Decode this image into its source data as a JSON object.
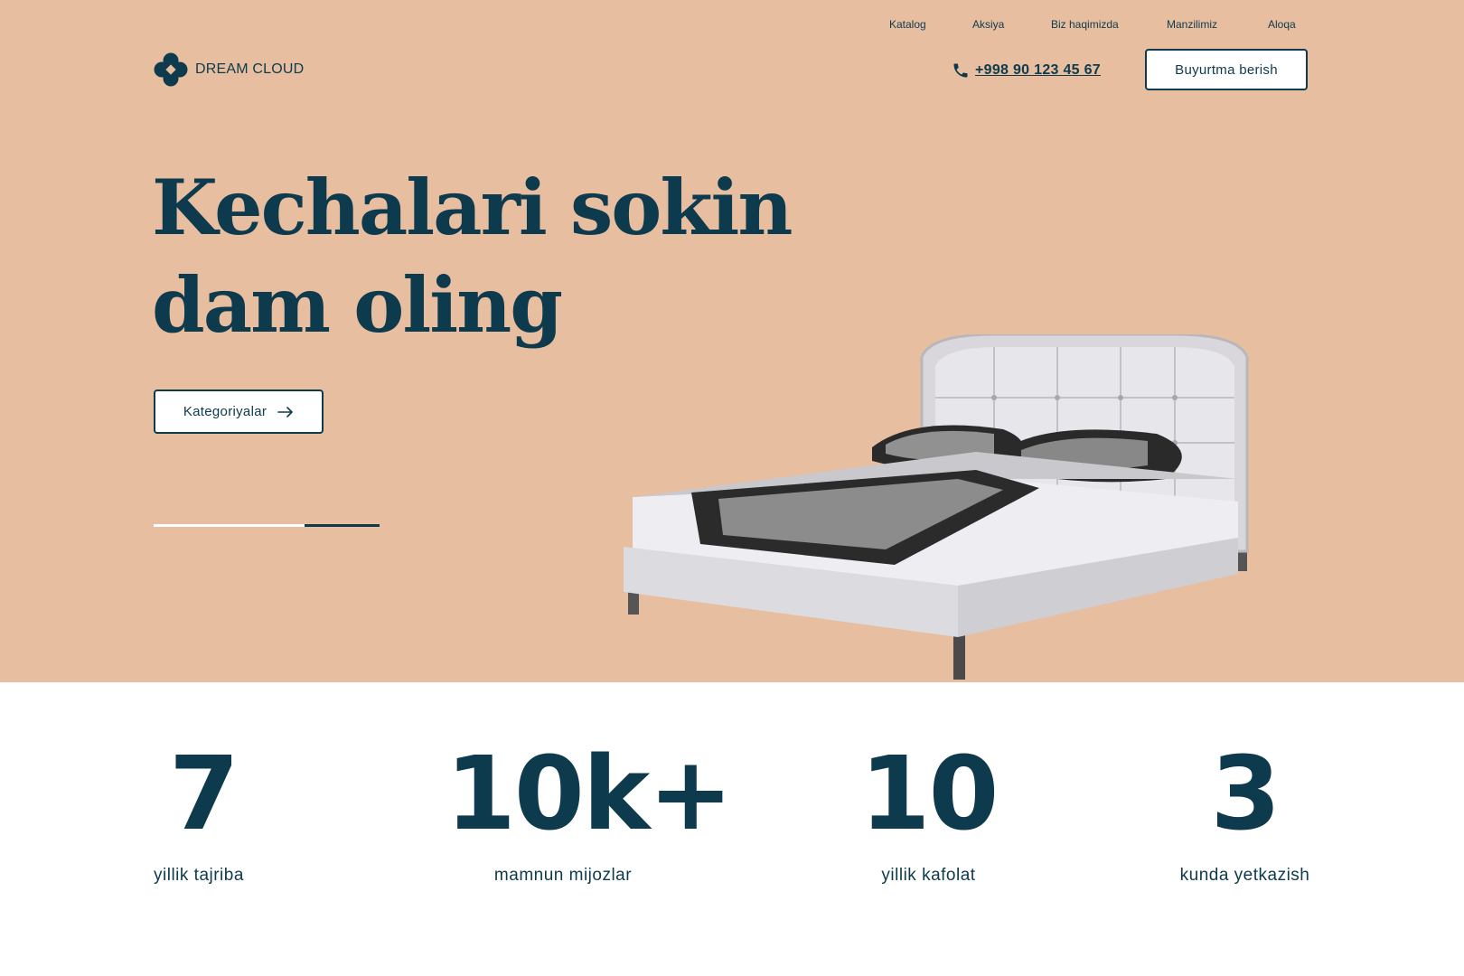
{
  "colors": {
    "hero_bg": "#e8bea0",
    "primary": "#0d3a4c",
    "surface": "#ffffff"
  },
  "nav": {
    "items": [
      "Katalog",
      "Aksiya",
      "Biz haqimizda",
      "Manzilimiz",
      "Aloqa"
    ]
  },
  "brand": {
    "name": "DREAM CLOUD",
    "logo_icon": "clover-logo-icon"
  },
  "contact": {
    "phone": "+998 90 123 45 67",
    "icon": "phone-icon"
  },
  "header": {
    "order_label": "Buyurtma berish"
  },
  "hero": {
    "headline_line1": "Kechalari sokin",
    "headline_line2": "dam oling",
    "cta_label": "Kategoriyalar",
    "cta_icon": "arrow-right-icon",
    "slider": {
      "total_slides": 3,
      "active_slide": 3
    },
    "image": "bed-icon"
  },
  "stats": [
    {
      "value": "7",
      "label": "yillik tajriba"
    },
    {
      "value": "10k+",
      "label": "mamnun mijozlar"
    },
    {
      "value": "10",
      "label": "yillik kafolat"
    },
    {
      "value": "3",
      "label": "kunda yetkazish"
    }
  ]
}
